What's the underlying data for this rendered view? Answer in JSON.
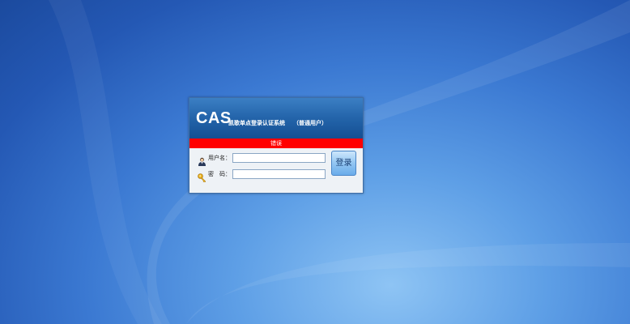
{
  "background": {
    "colors": {
      "primary": "#2458b4",
      "highlight": "#8ec4f4"
    }
  },
  "login": {
    "brand": "CAS",
    "system_title": "凯歌单点登录认证系统",
    "user_type": "（普通用户）",
    "error_message": "错误",
    "username": {
      "label": "用户名：",
      "icon": "user-icon",
      "value": "",
      "placeholder": ""
    },
    "password": {
      "label": "密　码：",
      "icon": "key-icon",
      "value": "",
      "placeholder": ""
    },
    "submit_label": "登录",
    "colors": {
      "header": "#2566ac",
      "error_bar": "#ff0000",
      "button": "#93c6f2"
    }
  }
}
